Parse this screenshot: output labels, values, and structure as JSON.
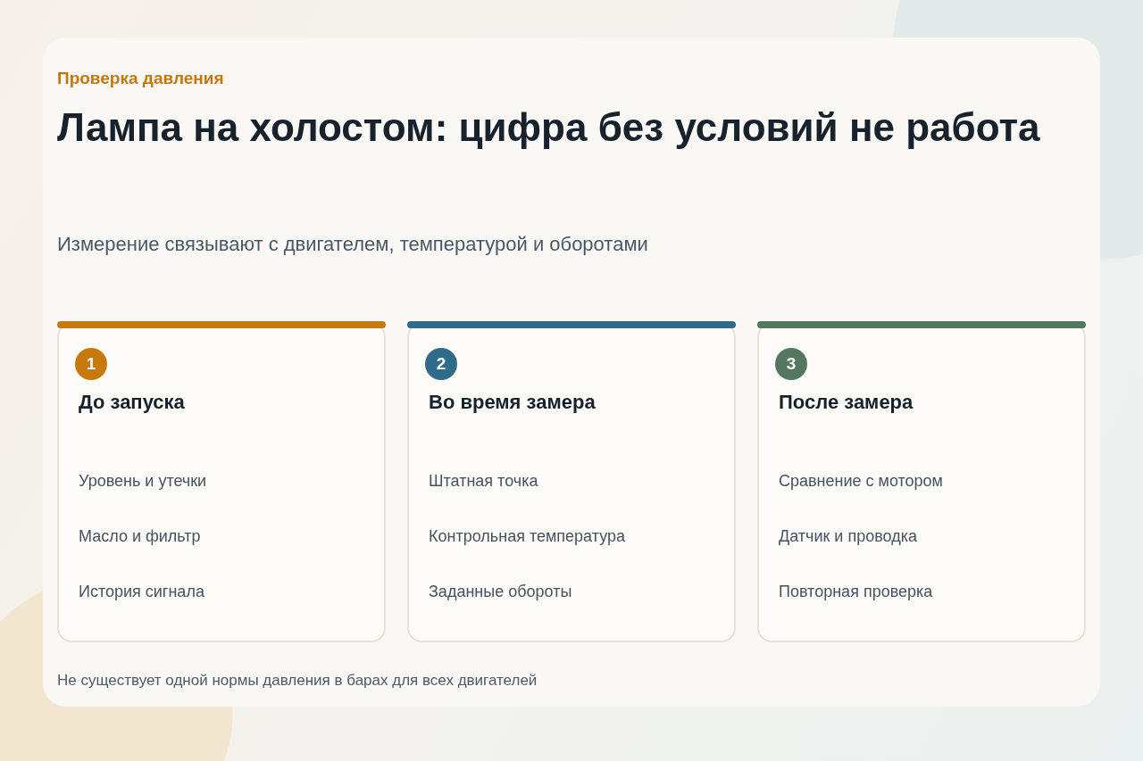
{
  "eyebrow": "Проверка давления",
  "title": "Лампа на холостом: цифра без условий не работа",
  "subtitle": "Измерение связывают с двигателем, температурой и оборотами",
  "steps": [
    {
      "number": "1",
      "title": "До запуска",
      "color": "#c8790e",
      "items": [
        "Уровень и утечки",
        "Масло и фильтр",
        "История сигнала"
      ]
    },
    {
      "number": "2",
      "title": "Во время замера",
      "color": "#2f6b8a",
      "items": [
        "Штатная точка",
        "Контрольная температура",
        "Заданные обороты"
      ]
    },
    {
      "number": "3",
      "title": "После замера",
      "color": "#53775f",
      "items": [
        "Сравнение с мотором",
        "Датчик и проводка",
        "Повторная проверка"
      ]
    }
  ],
  "footnote": "Не существует одной нормы давления в барах для всех двигателей"
}
